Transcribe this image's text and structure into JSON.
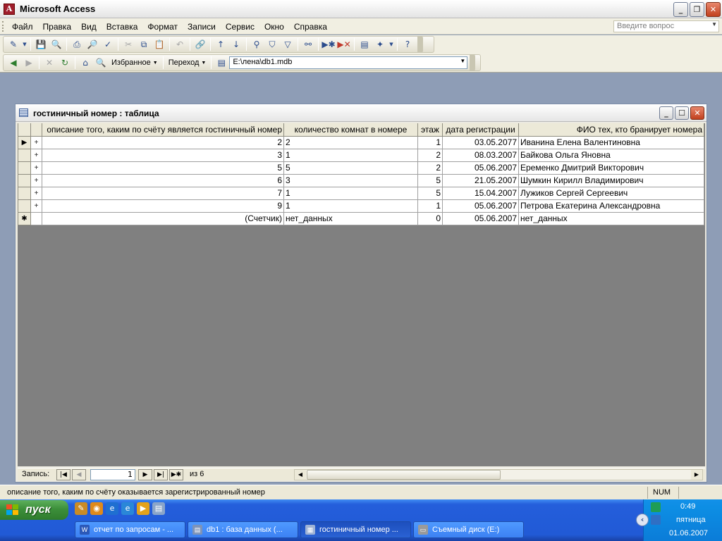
{
  "window": {
    "title": "Microsoft Access"
  },
  "menu": {
    "items": [
      "Файл",
      "Правка",
      "Вид",
      "Вставка",
      "Формат",
      "Записи",
      "Сервис",
      "Окно",
      "Справка"
    ],
    "ask_placeholder": "Введите вопрос"
  },
  "toolbar2": {
    "favorites_label": "Избранное",
    "goto_label": "Переход",
    "address": "E:\\лена\\db1.mdb"
  },
  "child": {
    "title": "гостиничный номер : таблица",
    "columns": [
      "описание того, каким по счёту является гостиничный номер",
      "количество комнат в номере",
      "этаж",
      "дата регистрации",
      "ФИО тех, кто бранирует номера"
    ],
    "rows": [
      [
        "2",
        "2",
        "1",
        "03.05.2077",
        "Иванина Елена Валентиновна"
      ],
      [
        "3",
        "1",
        "2",
        "08.03.2007",
        "Байкова Ольга Яновна"
      ],
      [
        "5",
        "5",
        "2",
        "05.06.2007",
        "Еременко Дмитрий Викторович"
      ],
      [
        "6",
        "3",
        "5",
        "21.05.2007",
        "Шумкин Кирилл Владимирович"
      ],
      [
        "7",
        "1",
        "5",
        "15.04.2007",
        "Лужиков Сергей Сергеевич"
      ],
      [
        "9",
        "1",
        "1",
        "05.06.2007",
        "Петрова Екатерина Александровна"
      ]
    ],
    "new_row": [
      "(Счетчик)",
      "нет_данных",
      "0",
      "05.06.2007",
      "нет_данных"
    ],
    "expand_symbol": "+",
    "new_row_symbol": "✱",
    "current_row_symbol": "▶"
  },
  "navigation": {
    "label": "Запись:",
    "current_record": "1",
    "of_text": "из 6"
  },
  "status": {
    "text": "описание того, каким по счёту оказывается зарегистрированный номер",
    "num": "NUM"
  },
  "taskbar": {
    "start_label": "пуск",
    "tasks": [
      {
        "label": "отчет по запросам - ...",
        "icon": "word-icon",
        "active": false
      },
      {
        "label": "db1 : база данных (...",
        "icon": "database-icon",
        "active": false
      },
      {
        "label": "гостиничный номер ...",
        "icon": "table-icon",
        "active": true
      },
      {
        "label": "Съемный диск (E:)",
        "icon": "drive-icon",
        "active": false
      }
    ],
    "clock": {
      "time": "0:49",
      "day": "пятница",
      "date": "01.06.2007"
    }
  }
}
